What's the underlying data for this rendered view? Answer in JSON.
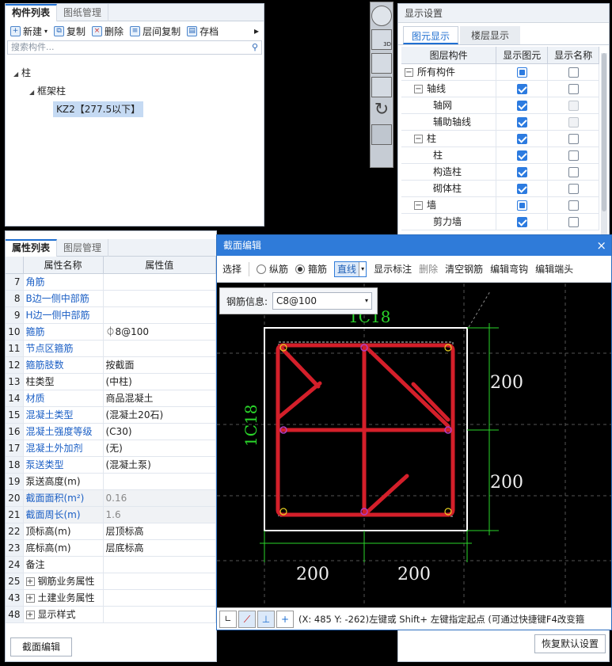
{
  "left_top": {
    "tabs": [
      "构件列表",
      "图纸管理"
    ],
    "toolbar": [
      {
        "icon": "new-icon",
        "label": "新建"
      },
      {
        "icon": "copy-icon",
        "label": "复制"
      },
      {
        "icon": "delete-icon",
        "label": "删除"
      },
      {
        "icon": "layer-copy-icon",
        "label": "层间复制"
      },
      {
        "icon": "archive-icon",
        "label": "存档"
      }
    ],
    "more": "▸",
    "search_placeholder": "搜索构件...",
    "tree": {
      "root": "柱",
      "child": "框架柱",
      "leaf": "KZ2【277.5以下】"
    }
  },
  "props": {
    "tabs": [
      "属性列表",
      "图层管理"
    ],
    "col_name": "属性名称",
    "col_value": "属性值",
    "rows": [
      {
        "n": "7",
        "name": "角筋",
        "value": "",
        "blue": true
      },
      {
        "n": "8",
        "name": "B边一侧中部筋",
        "value": "",
        "blue": true
      },
      {
        "n": "9",
        "name": "H边一侧中部筋",
        "value": "",
        "blue": true
      },
      {
        "n": "10",
        "name": "箍筋",
        "value": "⏀8@100",
        "blue": true
      },
      {
        "n": "11",
        "name": "节点区箍筋",
        "value": "",
        "blue": true
      },
      {
        "n": "12",
        "name": "箍筋肢数",
        "value": "按截面",
        "blue": true
      },
      {
        "n": "13",
        "name": "柱类型",
        "value": "(中柱)",
        "blue": false
      },
      {
        "n": "14",
        "name": "材质",
        "value": "商品混凝土",
        "blue": true
      },
      {
        "n": "15",
        "name": "混凝土类型",
        "value": "(混凝土20石)",
        "blue": true
      },
      {
        "n": "16",
        "name": "混凝土强度等级",
        "value": "(C30)",
        "blue": true
      },
      {
        "n": "17",
        "name": "混凝土外加剂",
        "value": "(无)",
        "blue": true
      },
      {
        "n": "18",
        "name": "泵送类型",
        "value": "(混凝土泵)",
        "blue": true
      },
      {
        "n": "19",
        "name": "泵送高度(m)",
        "value": "",
        "blue": false
      },
      {
        "n": "20",
        "name": "截面面积(m²)",
        "value": "0.16",
        "blue": true,
        "gray": true
      },
      {
        "n": "21",
        "name": "截面周长(m)",
        "value": "1.6",
        "blue": true,
        "gray": true
      },
      {
        "n": "22",
        "name": "顶标高(m)",
        "value": "层顶标高",
        "blue": false
      },
      {
        "n": "23",
        "name": "底标高(m)",
        "value": "层底标高",
        "blue": false
      },
      {
        "n": "24",
        "name": "备注",
        "value": "",
        "blue": false
      },
      {
        "n": "25",
        "name": "钢筋业务属性",
        "value": "",
        "blue": false,
        "group": true
      },
      {
        "n": "43",
        "name": "土建业务属性",
        "value": "",
        "blue": false,
        "group": true
      },
      {
        "n": "48",
        "name": "显示样式",
        "value": "",
        "blue": false,
        "group": true
      }
    ],
    "section_button": "截面编辑"
  },
  "display": {
    "title": "显示设置",
    "tabs": [
      "图元显示",
      "楼层显示"
    ],
    "headers": [
      "图层构件",
      "显示图元",
      "显示名称"
    ],
    "rows": [
      {
        "label": "所有构件",
        "level": 0,
        "exp": "−",
        "show": "part",
        "name": "off"
      },
      {
        "label": "轴线",
        "level": 1,
        "exp": "−",
        "show": "on",
        "name": "off"
      },
      {
        "label": "轴网",
        "level": 2,
        "exp": "",
        "show": "on",
        "name": "dis"
      },
      {
        "label": "辅助轴线",
        "level": 2,
        "exp": "",
        "show": "on",
        "name": "dis"
      },
      {
        "label": "柱",
        "level": 1,
        "exp": "−",
        "show": "on",
        "name": "off"
      },
      {
        "label": "柱",
        "level": 2,
        "exp": "",
        "show": "on",
        "name": "off"
      },
      {
        "label": "构造柱",
        "level": 2,
        "exp": "",
        "show": "on",
        "name": "off"
      },
      {
        "label": "砌体柱",
        "level": 2,
        "exp": "",
        "show": "on",
        "name": "off"
      },
      {
        "label": "墙",
        "level": 1,
        "exp": "−",
        "show": "part",
        "name": "off"
      },
      {
        "label": "剪力墙",
        "level": 2,
        "exp": "",
        "show": "on",
        "name": "off"
      }
    ],
    "restore_button": "恢复默认设置"
  },
  "section": {
    "title": "截面编辑",
    "close": "×",
    "select_label": "选择",
    "radio_long": "纵筋",
    "radio_stirrup": "箍筋",
    "line_mode": "直线",
    "show_label": "显示标注",
    "delete_label": "删除",
    "clear_label": "清空钢筋",
    "edit_hook": "编辑弯钩",
    "edit_end": "编辑端头",
    "rebar_info_label": "钢筋信息:",
    "rebar_info_value": "C8@100",
    "top_label": "1C18",
    "left_label": "1C18",
    "dim_right_top": "200",
    "dim_right_bottom": "200",
    "dim_bottom_left": "200",
    "dim_bottom_right": "200",
    "status": "(X: 485 Y: -262)左键或 Shift+ 左键指定起点 (可通过快捷键F4改变箍"
  },
  "colors": {
    "accent": "#1f6fd1",
    "rebar": "#d41f2a",
    "dim": "#2ad62a"
  }
}
